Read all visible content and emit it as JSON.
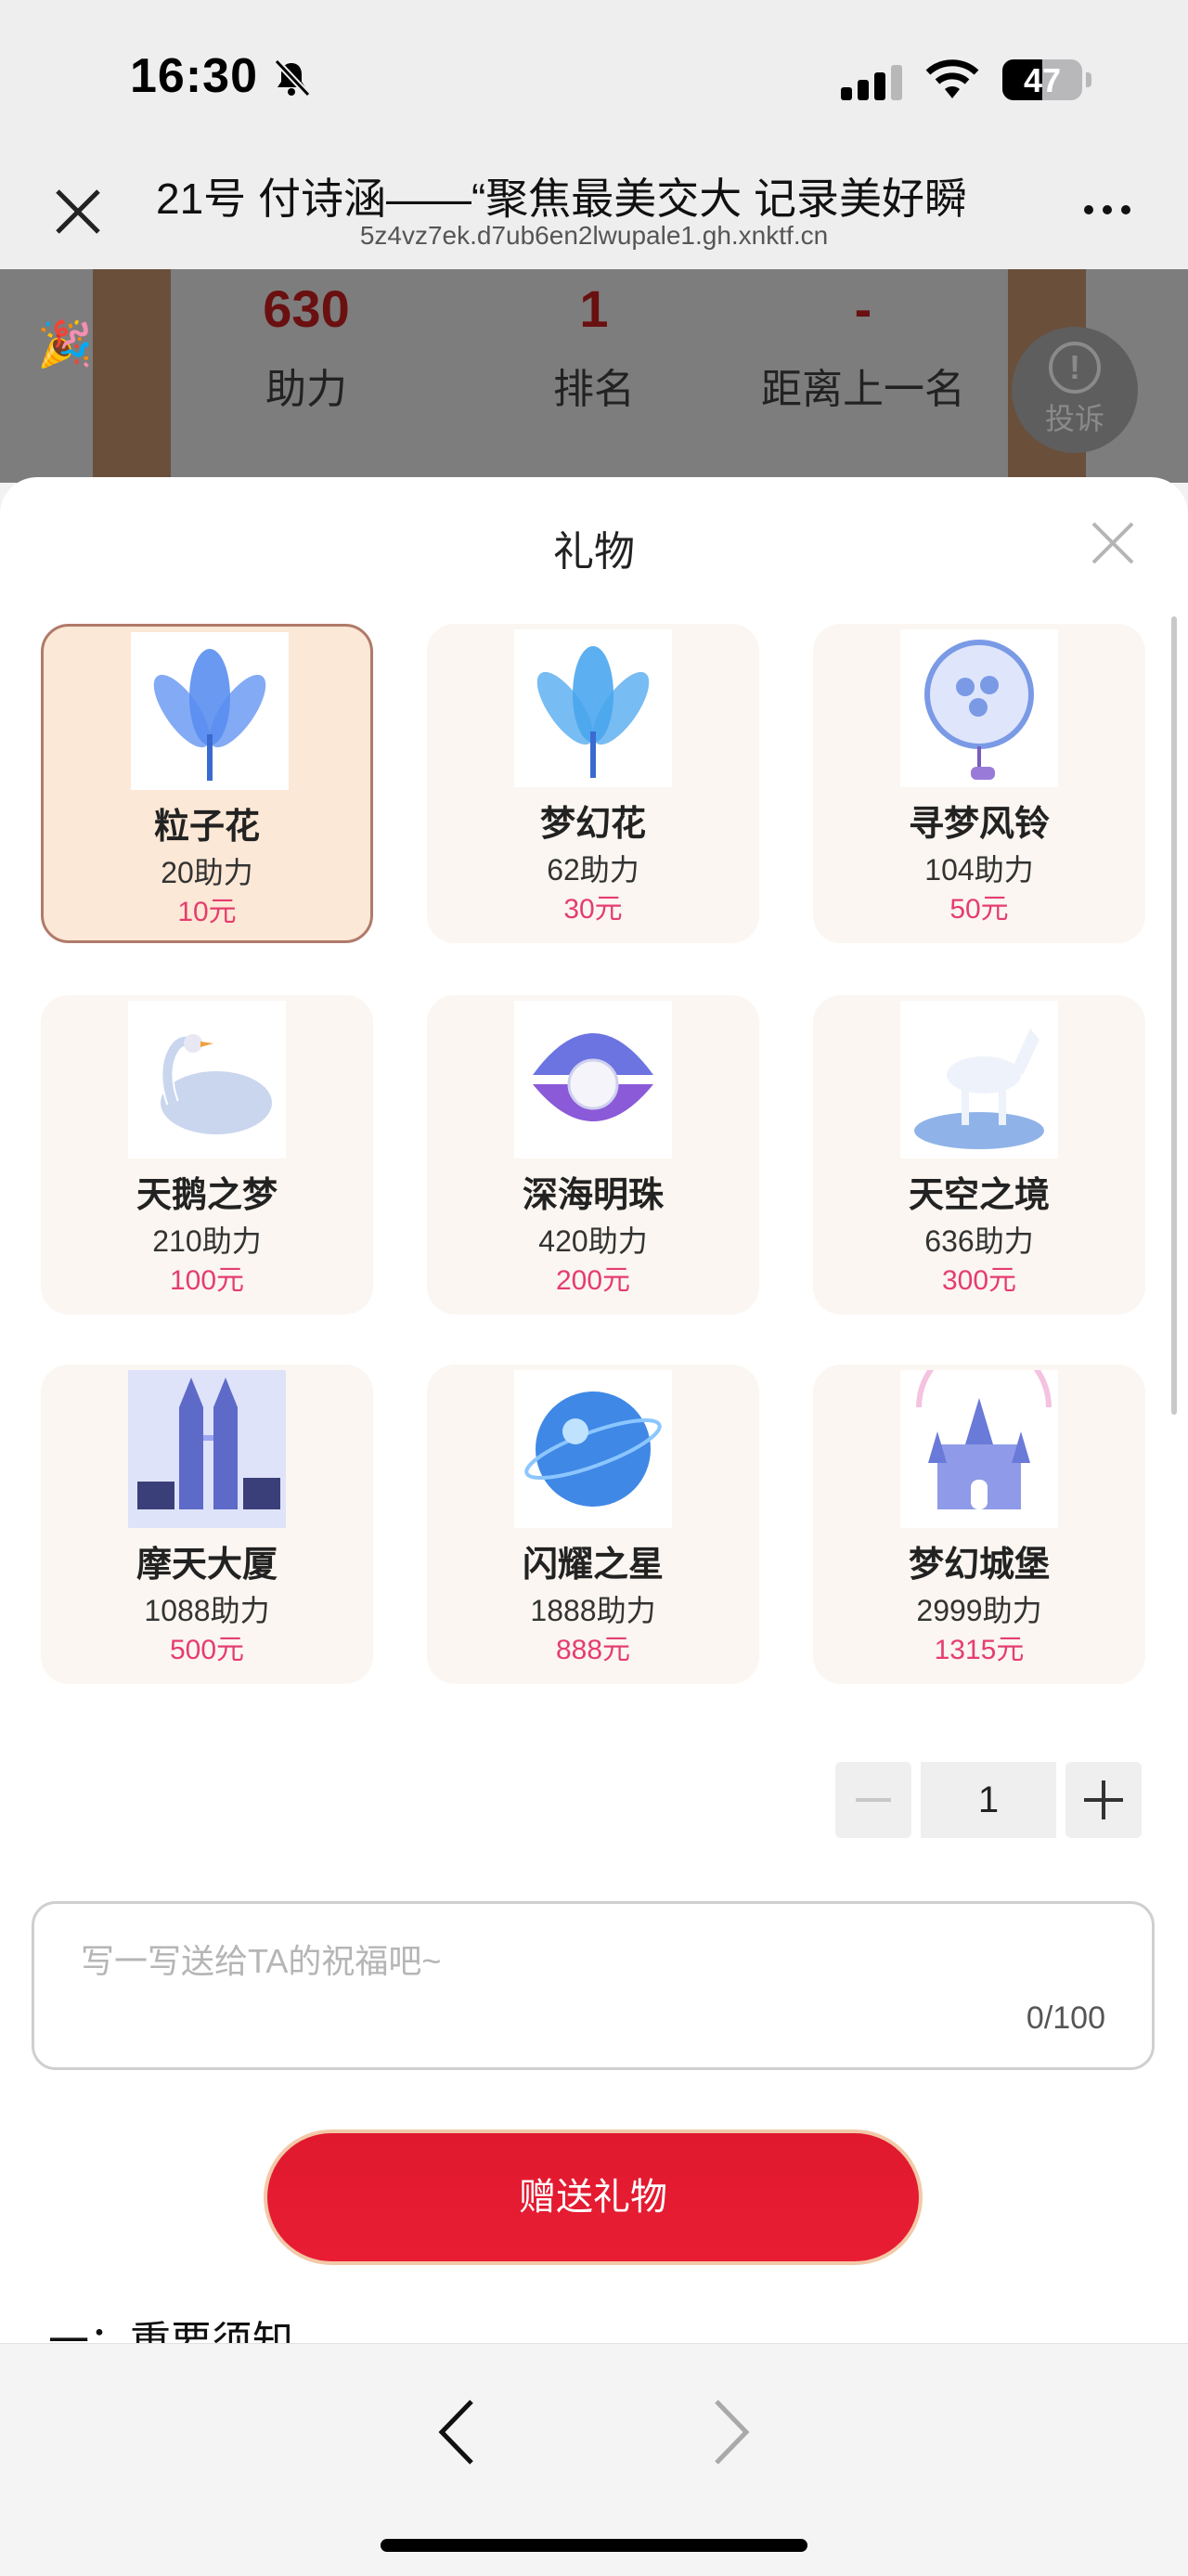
{
  "status_bar": {
    "time": "16:30",
    "battery": "47"
  },
  "header": {
    "title": "21号 付诗涵——“聚焦最美交大 记录美好瞬",
    "url": "5z4vz7ek.d7ub6en2lwupale1.gh.xnktf.cn"
  },
  "background": {
    "stats": [
      {
        "value": "630",
        "label": "助力"
      },
      {
        "value": "1",
        "label": "排名"
      },
      {
        "value": "-",
        "label": "距离上一名"
      }
    ],
    "report_label": "投诉"
  },
  "sheet": {
    "title": "礼物",
    "gifts": [
      {
        "name": "粒子花",
        "power": "20助力",
        "price": "10元",
        "selected": true,
        "color": "#5a8ef0"
      },
      {
        "name": "梦幻花",
        "power": "62助力",
        "price": "30元",
        "selected": false,
        "color": "#4aa6ee"
      },
      {
        "name": "寻梦风铃",
        "power": "104助力",
        "price": "50元",
        "selected": false,
        "color": "#7a9ae6"
      },
      {
        "name": "天鹅之梦",
        "power": "210助力",
        "price": "100元",
        "selected": false,
        "color": "#c9d6ee"
      },
      {
        "name": "深海明珠",
        "power": "420助力",
        "price": "200元",
        "selected": false,
        "color": "#6b74e0"
      },
      {
        "name": "天空之境",
        "power": "636助力",
        "price": "300元",
        "selected": false,
        "color": "#8fb3e8"
      },
      {
        "name": "摩天大厦",
        "power": "1088助力",
        "price": "500元",
        "selected": false,
        "color": "#5d6ac8"
      },
      {
        "name": "闪耀之星",
        "power": "1888助力",
        "price": "888元",
        "selected": false,
        "color": "#3f88e6"
      },
      {
        "name": "梦幻城堡",
        "power": "2999助力",
        "price": "1315元",
        "selected": false,
        "color": "#8f9be8"
      }
    ],
    "quantity": "1",
    "message": {
      "placeholder": "写一写送给TA的祝福吧~",
      "count": "0/100"
    },
    "send_label": "赠送礼物",
    "notice_label": "一：重要须知"
  }
}
